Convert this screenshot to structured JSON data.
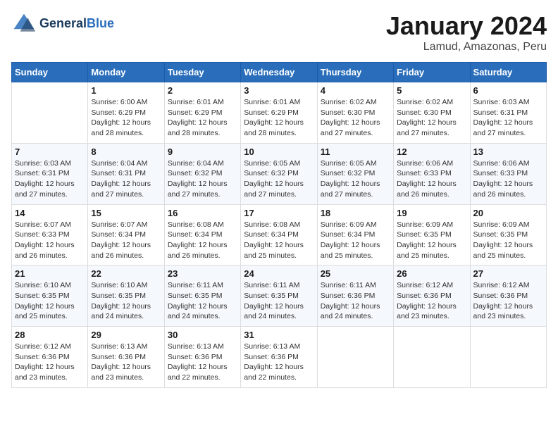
{
  "header": {
    "logo_line1": "General",
    "logo_line2": "Blue",
    "title": "January 2024",
    "subtitle": "Lamud, Amazonas, Peru"
  },
  "calendar": {
    "days_of_week": [
      "Sunday",
      "Monday",
      "Tuesday",
      "Wednesday",
      "Thursday",
      "Friday",
      "Saturday"
    ],
    "weeks": [
      [
        {
          "day": "",
          "info": ""
        },
        {
          "day": "1",
          "info": "Sunrise: 6:00 AM\nSunset: 6:29 PM\nDaylight: 12 hours\nand 28 minutes."
        },
        {
          "day": "2",
          "info": "Sunrise: 6:01 AM\nSunset: 6:29 PM\nDaylight: 12 hours\nand 28 minutes."
        },
        {
          "day": "3",
          "info": "Sunrise: 6:01 AM\nSunset: 6:29 PM\nDaylight: 12 hours\nand 28 minutes."
        },
        {
          "day": "4",
          "info": "Sunrise: 6:02 AM\nSunset: 6:30 PM\nDaylight: 12 hours\nand 27 minutes."
        },
        {
          "day": "5",
          "info": "Sunrise: 6:02 AM\nSunset: 6:30 PM\nDaylight: 12 hours\nand 27 minutes."
        },
        {
          "day": "6",
          "info": "Sunrise: 6:03 AM\nSunset: 6:31 PM\nDaylight: 12 hours\nand 27 minutes."
        }
      ],
      [
        {
          "day": "7",
          "info": "Sunrise: 6:03 AM\nSunset: 6:31 PM\nDaylight: 12 hours\nand 27 minutes."
        },
        {
          "day": "8",
          "info": "Sunrise: 6:04 AM\nSunset: 6:31 PM\nDaylight: 12 hours\nand 27 minutes."
        },
        {
          "day": "9",
          "info": "Sunrise: 6:04 AM\nSunset: 6:32 PM\nDaylight: 12 hours\nand 27 minutes."
        },
        {
          "day": "10",
          "info": "Sunrise: 6:05 AM\nSunset: 6:32 PM\nDaylight: 12 hours\nand 27 minutes."
        },
        {
          "day": "11",
          "info": "Sunrise: 6:05 AM\nSunset: 6:32 PM\nDaylight: 12 hours\nand 27 minutes."
        },
        {
          "day": "12",
          "info": "Sunrise: 6:06 AM\nSunset: 6:33 PM\nDaylight: 12 hours\nand 26 minutes."
        },
        {
          "day": "13",
          "info": "Sunrise: 6:06 AM\nSunset: 6:33 PM\nDaylight: 12 hours\nand 26 minutes."
        }
      ],
      [
        {
          "day": "14",
          "info": "Sunrise: 6:07 AM\nSunset: 6:33 PM\nDaylight: 12 hours\nand 26 minutes."
        },
        {
          "day": "15",
          "info": "Sunrise: 6:07 AM\nSunset: 6:34 PM\nDaylight: 12 hours\nand 26 minutes."
        },
        {
          "day": "16",
          "info": "Sunrise: 6:08 AM\nSunset: 6:34 PM\nDaylight: 12 hours\nand 26 minutes."
        },
        {
          "day": "17",
          "info": "Sunrise: 6:08 AM\nSunset: 6:34 PM\nDaylight: 12 hours\nand 25 minutes."
        },
        {
          "day": "18",
          "info": "Sunrise: 6:09 AM\nSunset: 6:34 PM\nDaylight: 12 hours\nand 25 minutes."
        },
        {
          "day": "19",
          "info": "Sunrise: 6:09 AM\nSunset: 6:35 PM\nDaylight: 12 hours\nand 25 minutes."
        },
        {
          "day": "20",
          "info": "Sunrise: 6:09 AM\nSunset: 6:35 PM\nDaylight: 12 hours\nand 25 minutes."
        }
      ],
      [
        {
          "day": "21",
          "info": "Sunrise: 6:10 AM\nSunset: 6:35 PM\nDaylight: 12 hours\nand 25 minutes."
        },
        {
          "day": "22",
          "info": "Sunrise: 6:10 AM\nSunset: 6:35 PM\nDaylight: 12 hours\nand 24 minutes."
        },
        {
          "day": "23",
          "info": "Sunrise: 6:11 AM\nSunset: 6:35 PM\nDaylight: 12 hours\nand 24 minutes."
        },
        {
          "day": "24",
          "info": "Sunrise: 6:11 AM\nSunset: 6:35 PM\nDaylight: 12 hours\nand 24 minutes."
        },
        {
          "day": "25",
          "info": "Sunrise: 6:11 AM\nSunset: 6:36 PM\nDaylight: 12 hours\nand 24 minutes."
        },
        {
          "day": "26",
          "info": "Sunrise: 6:12 AM\nSunset: 6:36 PM\nDaylight: 12 hours\nand 23 minutes."
        },
        {
          "day": "27",
          "info": "Sunrise: 6:12 AM\nSunset: 6:36 PM\nDaylight: 12 hours\nand 23 minutes."
        }
      ],
      [
        {
          "day": "28",
          "info": "Sunrise: 6:12 AM\nSunset: 6:36 PM\nDaylight: 12 hours\nand 23 minutes."
        },
        {
          "day": "29",
          "info": "Sunrise: 6:13 AM\nSunset: 6:36 PM\nDaylight: 12 hours\nand 23 minutes."
        },
        {
          "day": "30",
          "info": "Sunrise: 6:13 AM\nSunset: 6:36 PM\nDaylight: 12 hours\nand 22 minutes."
        },
        {
          "day": "31",
          "info": "Sunrise: 6:13 AM\nSunset: 6:36 PM\nDaylight: 12 hours\nand 22 minutes."
        },
        {
          "day": "",
          "info": ""
        },
        {
          "day": "",
          "info": ""
        },
        {
          "day": "",
          "info": ""
        }
      ]
    ]
  }
}
